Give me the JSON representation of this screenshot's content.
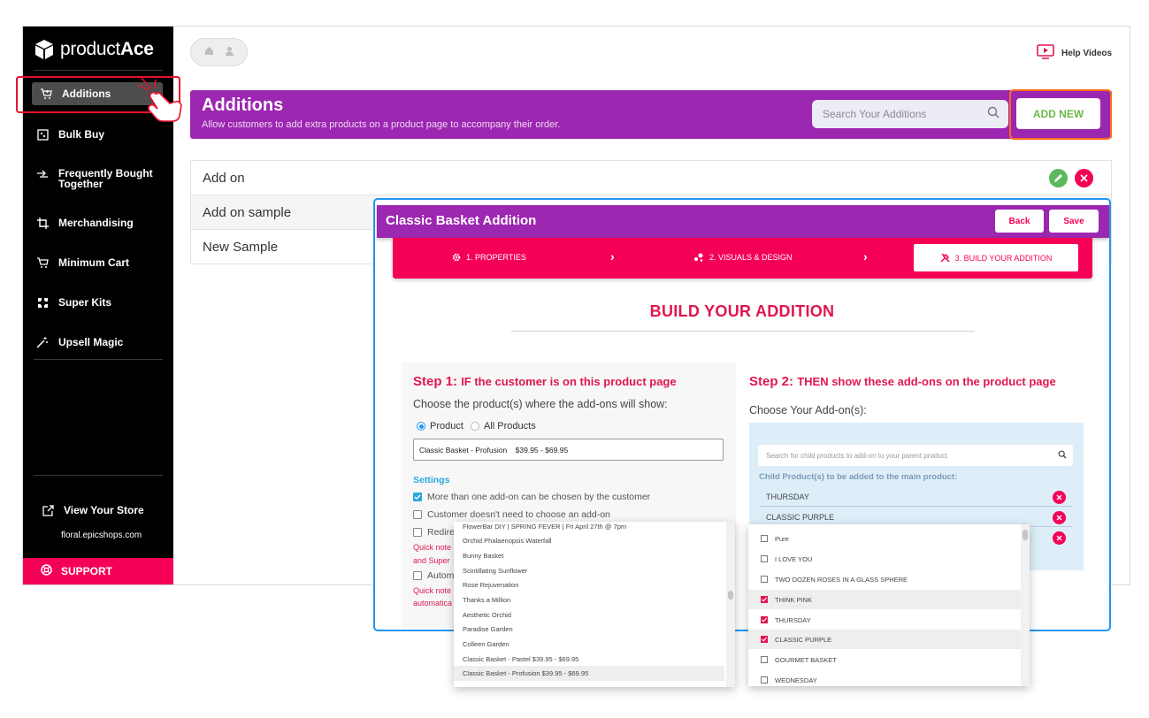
{
  "brand": {
    "name_light": "product",
    "name_bold": "Ace"
  },
  "sidebar": {
    "items": [
      {
        "label": "Additions",
        "icon": "cart-plus-icon"
      },
      {
        "label": "Bulk Buy",
        "icon": "boxes-icon"
      },
      {
        "label": "Frequently Bought Together",
        "icon": "arrows-icon"
      },
      {
        "label": "Merchandising",
        "icon": "crop-icon"
      },
      {
        "label": "Minimum Cart",
        "icon": "cart-icon"
      },
      {
        "label": "Super Kits",
        "icon": "kit-icon"
      },
      {
        "label": "Upsell Magic",
        "icon": "magic-wand-icon"
      }
    ],
    "view_store": "View Your Store",
    "store_url": "floral.epicshops.com",
    "support": "SUPPORT"
  },
  "header": {
    "help": "Help Videos"
  },
  "banner": {
    "title": "Additions",
    "subtitle": "Allow customers to add extra products on a product page to accompany their order.",
    "search_placeholder": "Search Your Additions",
    "add_new": "ADD NEW"
  },
  "list": {
    "rows": [
      "Add on",
      "Add on sample",
      "New Sample"
    ]
  },
  "modal": {
    "title": "Classic Basket Addition",
    "back": "Back",
    "save": "Save",
    "steps": [
      "1. PROPERTIES",
      "2. VISUALS & DESIGN",
      "3. BUILD YOUR ADDITION"
    ],
    "heading": "BUILD YOUR ADDITION",
    "step1": {
      "num": "Step 1:",
      "title": "IF the customer is on this product page",
      "label": "Choose the product(s) where the add-ons will show:",
      "radio_product": "Product",
      "radio_all": "All Products",
      "selected_product": "Classic Basket - Profusion    $39.95 - $69.95",
      "settings": "Settings",
      "opt1": "More than one add-on can be chosen by the customer",
      "opt2": "Customer doesn't need to choose an add-on",
      "opt3": "Redire",
      "note1a": "Quick note",
      "note1b": "and Super",
      "opt4": "Autom",
      "note2a": "Quick note",
      "note2b": "automatica"
    },
    "step2": {
      "num": "Step 2:",
      "title": "THEN show these add-ons on the product page",
      "label": "Choose Your Add-on(s):",
      "search_placeholder": "Search for child products to add-on to your parent product",
      "child_label": "Child Product(s) to be added to the main product:",
      "children": [
        "THURSDAY",
        "CLASSIC PURPLE"
      ]
    }
  },
  "dropdown_products": [
    "FlowerBar DIY | SPRING FEVER | Fri April 27th @ 7pm",
    "Orchid Phalaenopsis Waterfall",
    "Bunny Basket",
    "Scintillating Sunflower",
    "Rose Rejuvenation",
    "Thanks a Million",
    "Aesthetic Orchid",
    "Paradise Garden",
    "Colleen Garden",
    "Classic Basket - Pastel $39.95 - $69.95",
    "Classic Basket - Profusion $39.95 - $69.95"
  ],
  "dropdown_addons": [
    {
      "label": "Pure",
      "checked": false
    },
    {
      "label": "I LOVE YOU",
      "checked": false
    },
    {
      "label": "TWO DOZEN ROSES IN A GLASS SPHERE",
      "checked": false
    },
    {
      "label": "THINK PINK",
      "checked": true
    },
    {
      "label": "THURSDAY",
      "checked": true
    },
    {
      "label": "CLASSIC PURPLE",
      "checked": true
    },
    {
      "label": "GOURMET BASKET",
      "checked": false
    },
    {
      "label": "WEDNESDAY",
      "checked": false
    }
  ],
  "colors": {
    "purple": "#9c27b0",
    "pink": "#f50057",
    "green": "#6dbb4b",
    "blue": "#2196f3",
    "highlight": "#ff6a1a"
  }
}
